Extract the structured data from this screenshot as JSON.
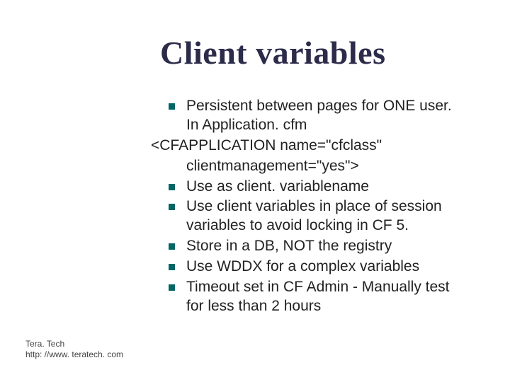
{
  "title": "Client variables",
  "lines": {
    "b1": "Persistent between pages for ONE user. In Application. cfm",
    "code1": "<CFAPPLICATION name=\"cfclass\"",
    "code2": "clientmanagement=\"yes\">",
    "b2": "Use as client. variablename",
    "b3": "Use client variables in place of session variables to avoid locking in CF 5.",
    "b4": "Store in a DB, NOT the registry",
    "b5": "Use WDDX for a complex variables",
    "b6": "Timeout set in CF Admin - Manually test for less than 2 hours"
  },
  "footer": {
    "line1": "Tera. Tech",
    "line2": "http: //www. teratech. com"
  }
}
